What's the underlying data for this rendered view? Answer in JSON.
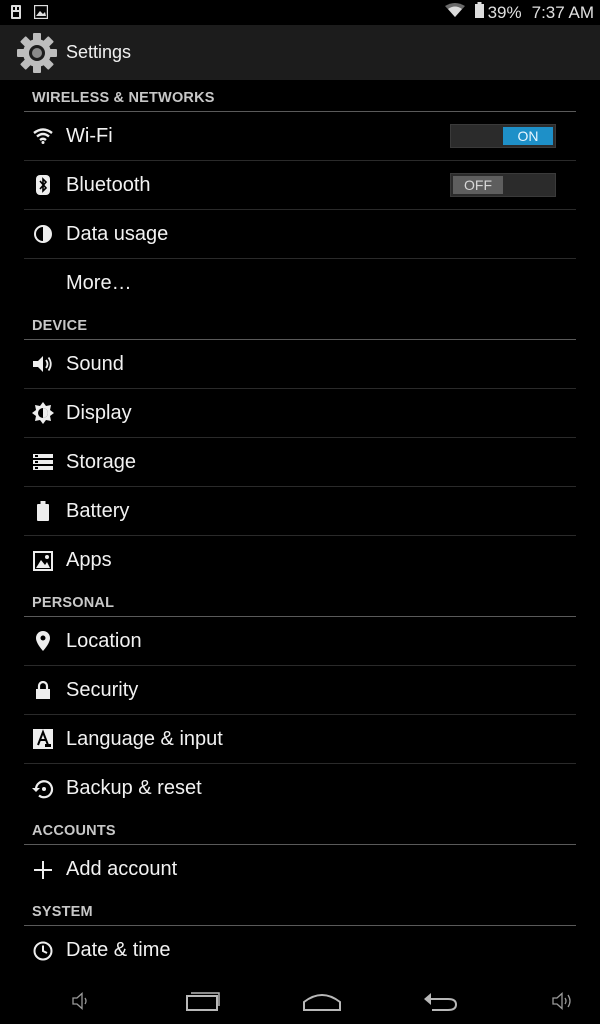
{
  "status_bar": {
    "battery_percent": "39%",
    "time": "7:37 AM"
  },
  "action_bar": {
    "title": "Settings"
  },
  "sections": {
    "wireless": {
      "header": "WIRELESS & NETWORKS",
      "wifi": {
        "label": "Wi-Fi",
        "toggle": "ON"
      },
      "bluetooth": {
        "label": "Bluetooth",
        "toggle": "OFF"
      },
      "data_usage": {
        "label": "Data usage"
      },
      "more": {
        "label": "More…"
      }
    },
    "device": {
      "header": "DEVICE",
      "sound": {
        "label": "Sound"
      },
      "display": {
        "label": "Display"
      },
      "storage": {
        "label": "Storage"
      },
      "battery": {
        "label": "Battery"
      },
      "apps": {
        "label": "Apps"
      }
    },
    "personal": {
      "header": "PERSONAL",
      "location": {
        "label": "Location"
      },
      "security": {
        "label": "Security"
      },
      "language": {
        "label": "Language & input"
      },
      "backup": {
        "label": "Backup & reset"
      }
    },
    "accounts": {
      "header": "ACCOUNTS",
      "add_account": {
        "label": "Add account"
      }
    },
    "system": {
      "header": "SYSTEM",
      "date_time": {
        "label": "Date & time"
      }
    }
  },
  "colors": {
    "accent": "#1e90c8",
    "background": "#000000",
    "action_bar": "#1c1c1c"
  }
}
